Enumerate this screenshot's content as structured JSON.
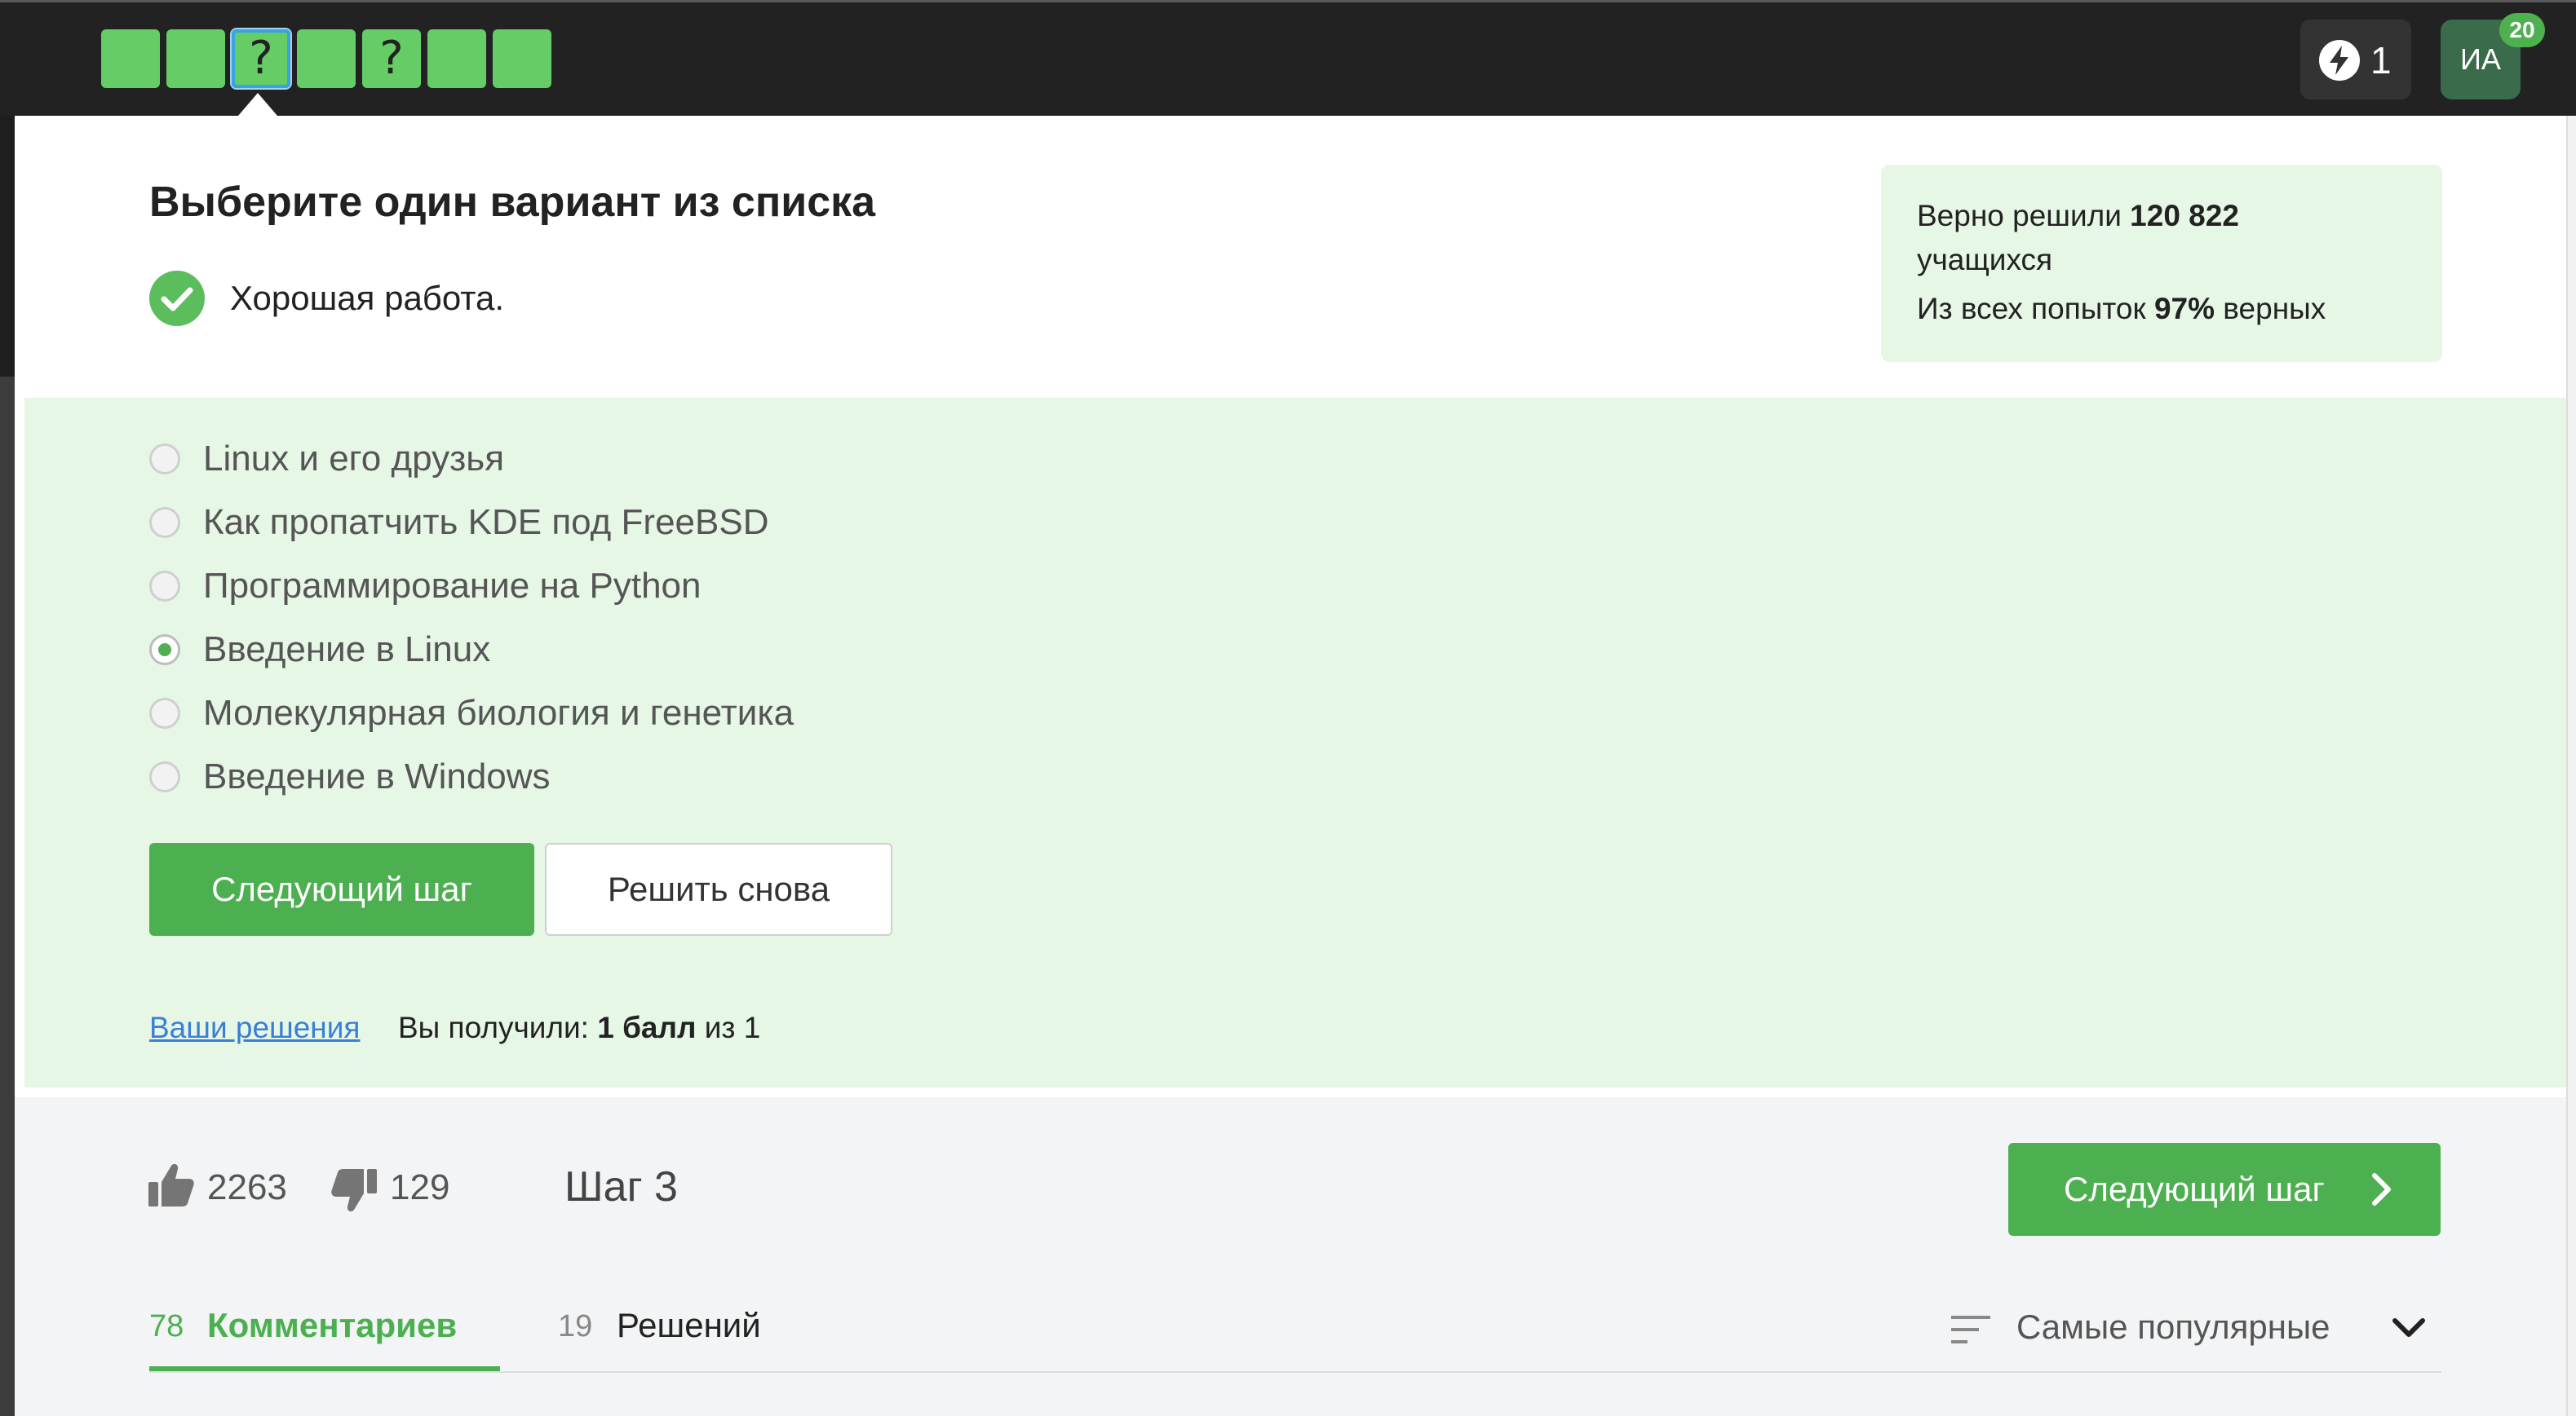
{
  "topbar": {
    "steps": [
      {
        "mark": ""
      },
      {
        "mark": ""
      },
      {
        "mark": "?"
      },
      {
        "mark": ""
      },
      {
        "mark": "?"
      },
      {
        "mark": ""
      },
      {
        "mark": ""
      }
    ],
    "energy_count": "1",
    "avatar_initials": "ИА",
    "avatar_badge": "20"
  },
  "task": {
    "title": "Выберите один вариант из списка",
    "feedback": "Хорошая работа."
  },
  "stats": {
    "line1_prefix": "Верно решили ",
    "solved_count": "120 822",
    "line1_suffix": "учащихся",
    "line2_prefix": "Из всех попыток ",
    "percent": "97%",
    "line2_suffix": " верных"
  },
  "options": [
    {
      "label": "Linux и его друзья",
      "selected": false
    },
    {
      "label": "Как пропатчить KDE под FreeBSD",
      "selected": false
    },
    {
      "label": "Программирование на Python",
      "selected": false
    },
    {
      "label": "Введение в Linux",
      "selected": true
    },
    {
      "label": "Молекулярная биология и генетика",
      "selected": false
    },
    {
      "label": "Введение в Windows",
      "selected": false
    }
  ],
  "actions": {
    "next_label": "Следующий шаг",
    "retry_label": "Решить снова",
    "solutions_link": "Ваши решения",
    "score_prefix": "Вы получили: ",
    "score_value": "1 балл",
    "score_suffix": " из 1"
  },
  "footer": {
    "likes": "2263",
    "dislikes": "129",
    "step_label": "Шаг 3",
    "next_label": "Следующий шаг",
    "comments_count": "78",
    "comments_label": "Комментариев",
    "solutions_count": "19",
    "solutions_label": "Решений",
    "sort_label": "Самые популярные"
  },
  "colors": {
    "accent": "#4caf50",
    "step_green": "#66cc66",
    "panel_bg": "#e6f7e6",
    "topbar_bg": "#222222",
    "link": "#3a7fd5"
  }
}
